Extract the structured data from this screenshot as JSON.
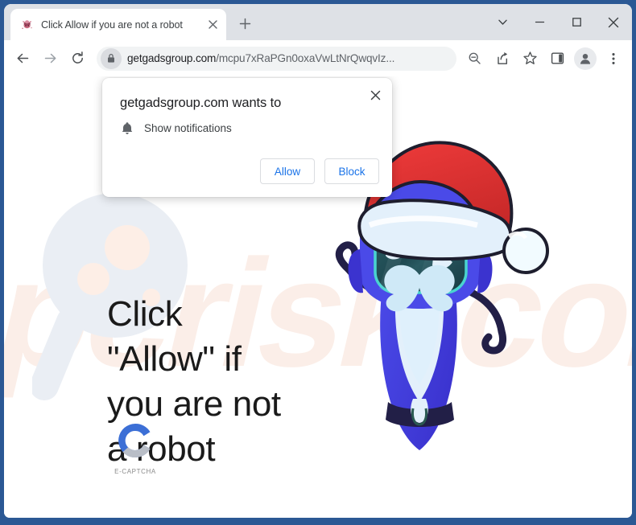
{
  "window": {
    "controls": [
      {
        "name": "tab-search-button",
        "glyph": "chevron-down"
      },
      {
        "name": "minimize-button",
        "glyph": "minimize"
      },
      {
        "name": "maximize-button",
        "glyph": "maximize"
      },
      {
        "name": "close-button",
        "glyph": "close"
      }
    ],
    "frame_color": "#2b5894"
  },
  "tab": {
    "title": "Click Allow if you are not a robot",
    "favicon": "site-favicon",
    "close_label": "×",
    "new_tab_label": "+"
  },
  "toolbar": {
    "back_label": "←",
    "forward_label": "→",
    "reload_label": "⟳",
    "url_domain": "getgadsgroup.com",
    "url_path": "/mcpu7xRaPGn0oxaVwLtNrQwqvIz...",
    "lock_icon": "lock-icon",
    "zoom_icon": "zoom-out-icon",
    "share_icon": "share-icon",
    "bookmark_icon": "bookmark-star-icon",
    "sidepanel_icon": "side-panel-icon",
    "profile_icon": "profile-avatar-icon",
    "menu_icon": "three-dot-menu-icon"
  },
  "dialog": {
    "title": "getgadsgroup.com wants to",
    "permission": "Show notifications",
    "permission_icon": "bell-icon",
    "close_label": "×",
    "allow_label": "Allow",
    "block_label": "Block",
    "button_text_color": "#1a73e8"
  },
  "page": {
    "headline": "Click \"Allow\" if you are not a robot",
    "headline_lines": [
      "Click",
      "\"Allow\" if",
      "you are not",
      "a robot"
    ],
    "captcha_logo_letter": "C",
    "captcha_label": "E-CAPTCHA",
    "watermark_text": "pcrisk.com",
    "illustration": "santa-robot-illustration",
    "background_decor": "magnifying-glass-watermark"
  }
}
